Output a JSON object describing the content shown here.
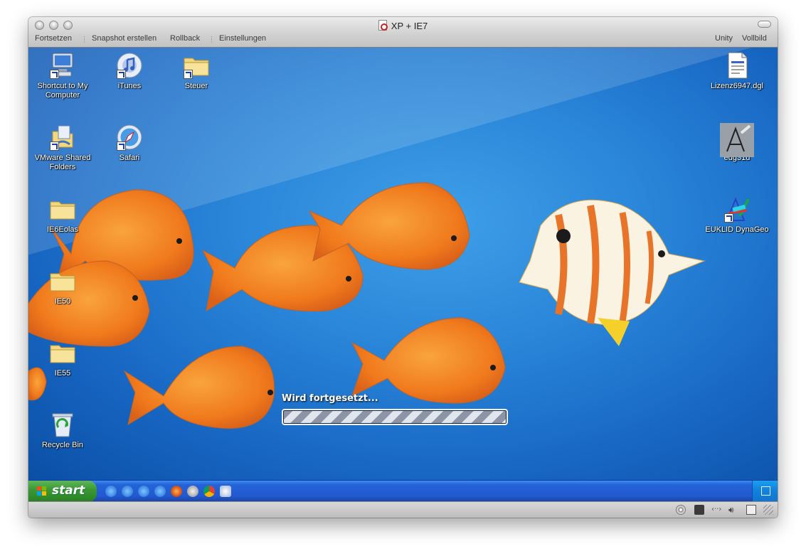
{
  "window": {
    "title": "XP + IE7",
    "toolbar": {
      "resume": "Fortsetzen",
      "snapshot": "Snapshot erstellen",
      "rollback": "Rollback",
      "settings": "Einstellungen",
      "unity": "Unity",
      "fullscreen": "Vollbild"
    }
  },
  "desktop": {
    "icons_left": [
      {
        "label": "Shortcut to My Computer",
        "icon": "my-computer-icon"
      },
      {
        "label": "iTunes",
        "icon": "itunes-icon"
      },
      {
        "label": "Steuer",
        "icon": "folder-icon"
      },
      {
        "label": "VMware Shared Folders",
        "icon": "shared-folders-icon"
      },
      {
        "label": "Safari",
        "icon": "safari-icon"
      },
      {
        "label": "IE6Eolas",
        "icon": "folder-icon"
      },
      {
        "label": "IE50",
        "icon": "folder-icon"
      },
      {
        "label": "IE55",
        "icon": "folder-icon"
      },
      {
        "label": "Recycle Bin",
        "icon": "recycle-bin-icon"
      }
    ],
    "icons_right": [
      {
        "label": "Lizenz6947.dgl",
        "icon": "document-icon"
      },
      {
        "label": "edg31d",
        "icon": "geometry-tool-icon"
      },
      {
        "label": "EUKLID DynaGeo",
        "icon": "dynageo-icon"
      }
    ],
    "progress": {
      "label": "Wird fortgesetzt...",
      "state": "indeterminate"
    }
  },
  "taskbar": {
    "start_label": "start",
    "quick_launch": [
      "ie-icon",
      "ie-icon",
      "ie-icon",
      "ie-icon",
      "firefox-icon",
      "opera-icon",
      "chrome-icon",
      "misc-icon"
    ]
  },
  "colors": {
    "desktop_blue": "#2a86d9",
    "taskbar_blue": "#2258d0",
    "start_green": "#3c9a36",
    "fish_orange": "#f07a1c"
  }
}
